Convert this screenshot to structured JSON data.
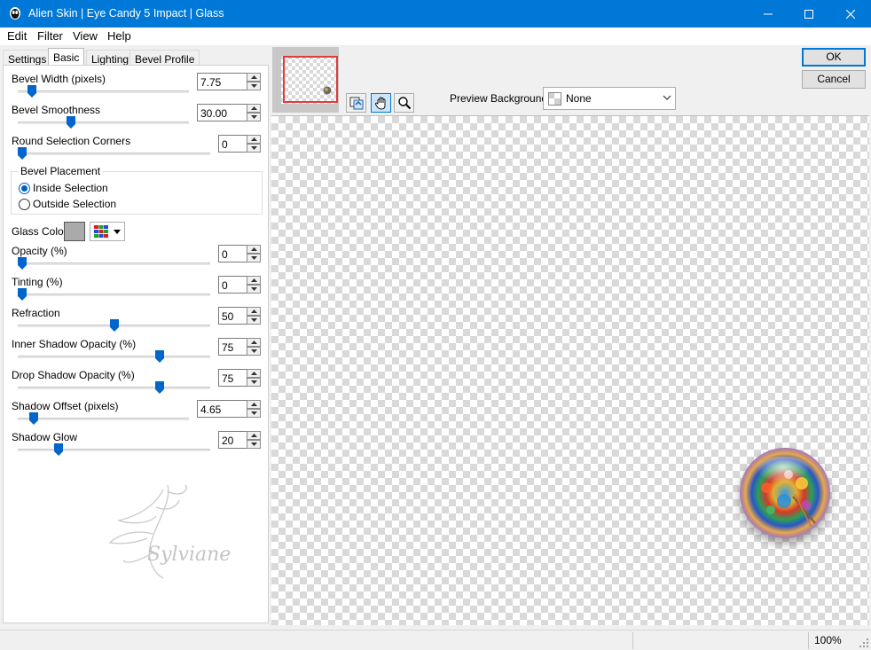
{
  "window": {
    "title": "Alien Skin | Eye Candy 5 Impact | Glass",
    "accent": "#0078d7"
  },
  "menu": [
    "Edit",
    "Filter",
    "View",
    "Help"
  ],
  "tabs": [
    "Settings",
    "Basic",
    "Lighting",
    "Bevel Profile"
  ],
  "active_tab": "Basic",
  "controls": {
    "bevel_width": {
      "label": "Bevel Width (pixels)",
      "value": "7.75",
      "slider_fraction": 0.06
    },
    "bevel_smoothness": {
      "label": "Bevel Smoothness",
      "value": "30.00",
      "slider_fraction": 0.3
    },
    "round_selection_corners": {
      "label": "Round Selection Corners",
      "value": "0",
      "slider_fraction": 0.0
    },
    "opacity": {
      "label": "Opacity (%)",
      "value": "0",
      "slider_fraction": 0.0
    },
    "tinting": {
      "label": "Tinting (%)",
      "value": "0",
      "slider_fraction": 0.0
    },
    "refraction": {
      "label": "Refraction",
      "value": "50",
      "slider_fraction": 0.5
    },
    "inner_shadow_opacity": {
      "label": "Inner Shadow Opacity (%)",
      "value": "75",
      "slider_fraction": 0.75
    },
    "drop_shadow_opacity": {
      "label": "Drop Shadow Opacity (%)",
      "value": "75",
      "slider_fraction": 0.75
    },
    "shadow_offset": {
      "label": "Shadow Offset (pixels)",
      "value": "4.65",
      "slider_fraction": 0.07
    },
    "shadow_glow": {
      "label": "Shadow Glow",
      "value": "20",
      "slider_fraction": 0.2
    }
  },
  "bevel_placement": {
    "legend": "Bevel Placement",
    "options": [
      "Inside Selection",
      "Outside Selection"
    ],
    "selected": "Inside Selection"
  },
  "glass_color": {
    "label": "Glass Color",
    "color": "#aaaaaa"
  },
  "watermark_text": "Sylviane",
  "preview": {
    "background_label": "Preview Background:",
    "background_value": "None"
  },
  "buttons": {
    "ok": "OK",
    "cancel": "Cancel"
  },
  "status": {
    "zoom": "100%"
  }
}
